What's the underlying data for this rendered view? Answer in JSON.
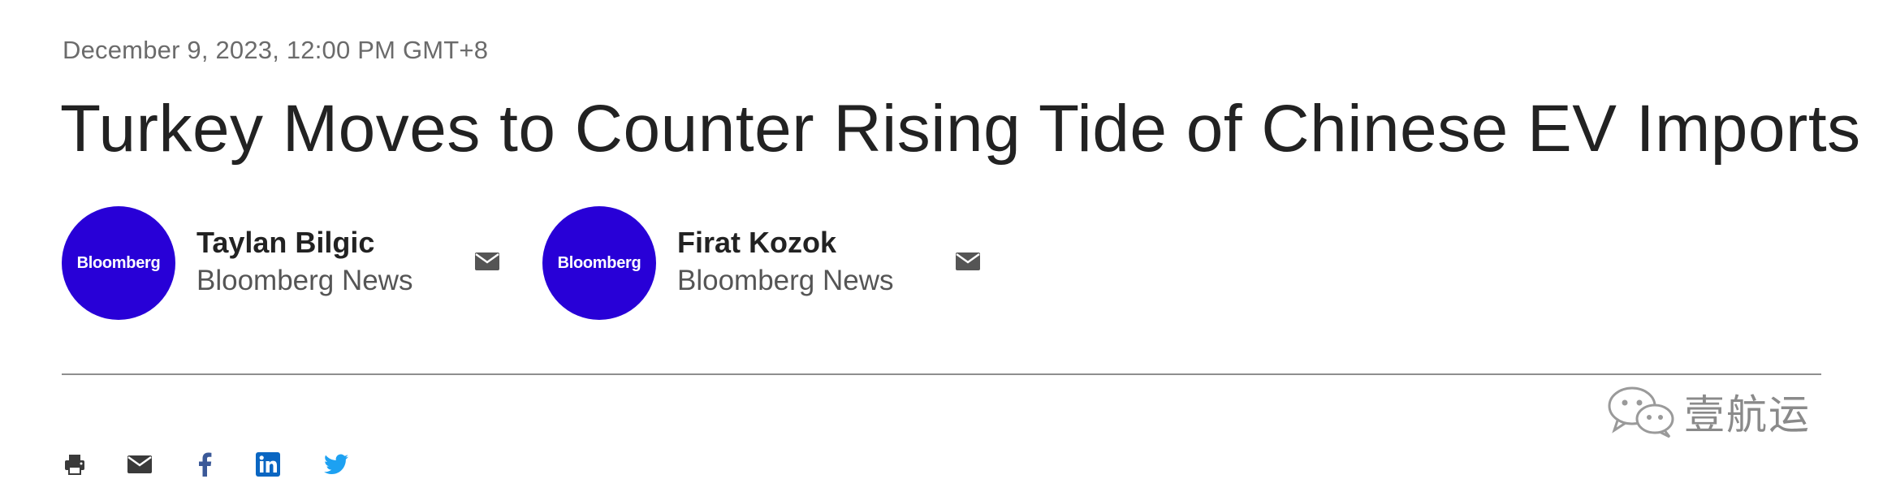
{
  "article": {
    "timestamp": "December 9, 2023, 12:00 PM GMT+8",
    "headline": "Turkey Moves to Counter Rising Tide of Chinese EV Imports"
  },
  "authors": [
    {
      "name": "Taylan Bilgic",
      "org": "Bloomberg News",
      "avatar_label": "Bloomberg"
    },
    {
      "name": "Firat Kozok",
      "org": "Bloomberg News",
      "avatar_label": "Bloomberg"
    }
  ],
  "share": {
    "items": [
      "print-icon",
      "email-icon",
      "facebook-icon",
      "linkedin-icon",
      "twitter-icon"
    ]
  },
  "watermark": {
    "text": "壹航运",
    "icon": "wechat-icon"
  },
  "colors": {
    "avatar_bg": "#2800d7",
    "share_icon": "#3a3a3a",
    "facebook": "#3b5998",
    "linkedin": "#0a66c2",
    "twitter": "#1da1f2"
  }
}
